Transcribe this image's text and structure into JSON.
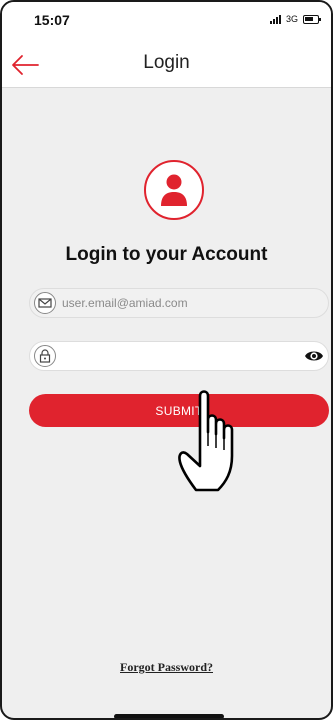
{
  "status_bar": {
    "time": "15:07",
    "network": "3G",
    "signal_icon": "signal-bars-icon",
    "battery_icon": "battery-icon"
  },
  "header": {
    "title": "Login",
    "back_icon": "arrow-left-icon"
  },
  "main": {
    "avatar_icon": "user-icon",
    "heading": "Login to your Account",
    "email_field": {
      "icon": "envelope-icon",
      "value": "",
      "placeholder": "user.email@amiad.com"
    },
    "password_field": {
      "icon": "lock-icon",
      "value": "",
      "placeholder": "",
      "toggle_icon": "eye-icon"
    },
    "submit_label": "SUBMIT",
    "forgot_password": "Forgot Password?"
  },
  "overlay": {
    "pointer_icon": "hand-pointer-icon"
  },
  "colors": {
    "accent": "#e0232e",
    "background": "#efefef",
    "surface": "#ffffff"
  }
}
